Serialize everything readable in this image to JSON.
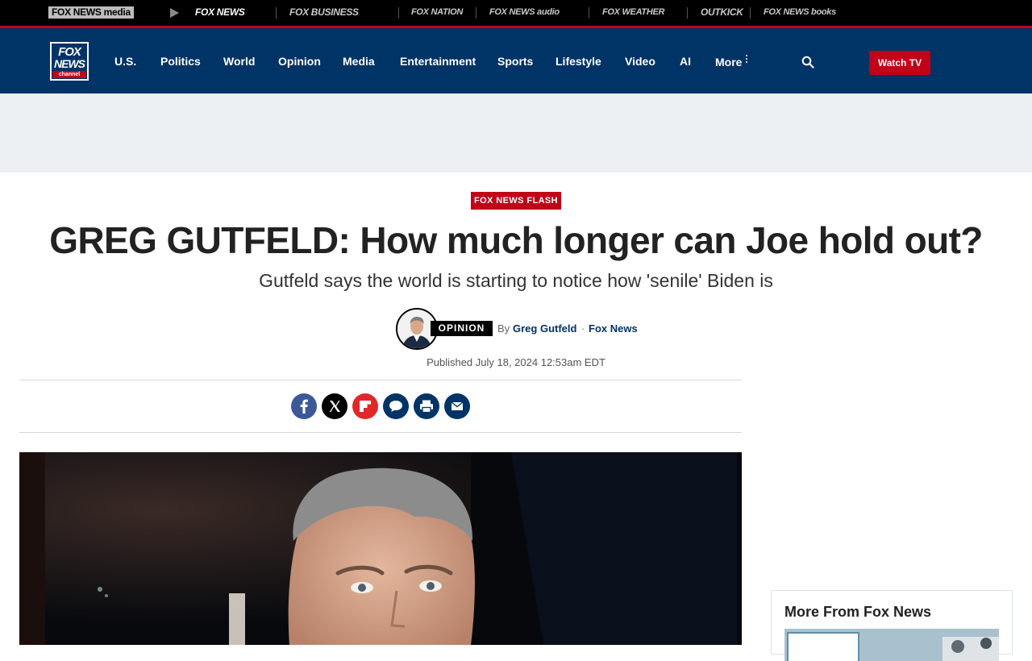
{
  "network_bar": {
    "items": [
      "FOX NEWS media",
      "FOX NEWS",
      "FOX BUSINESS",
      "FOX NATION",
      "FOX NEWS audio",
      "FOX WEATHER",
      "OUTKICK",
      "FOX NEWS books"
    ]
  },
  "header": {
    "logo": {
      "line1": "FOX",
      "line2": "NEWS",
      "line3": "channel"
    },
    "nav": [
      "U.S.",
      "Politics",
      "World",
      "Opinion",
      "Media",
      "Entertainment",
      "Sports",
      "Lifestyle",
      "Video",
      "AI",
      "More"
    ],
    "watch_tv": "Watch TV"
  },
  "article": {
    "eyebrow": "FOX NEWS FLASH",
    "headline": "GREG GUTFELD: How much longer can Joe hold out?",
    "subhead": "Gutfeld says the world is starting to notice how 'senile' Biden is",
    "byline": {
      "tag": "OPINION",
      "by": "By",
      "author": "Greg Gutfeld",
      "separator": "·",
      "outlet": "Fox News"
    },
    "published": "Published July 18, 2024 12:53am EDT",
    "share": [
      "facebook-icon",
      "x-icon",
      "flipboard-icon",
      "comments-icon",
      "print-icon",
      "email-icon"
    ]
  },
  "sidebar": {
    "title": "More From Fox News"
  },
  "colors": {
    "navy": "#003366",
    "red": "#c20017",
    "ad_bg": "#edf0f2"
  }
}
